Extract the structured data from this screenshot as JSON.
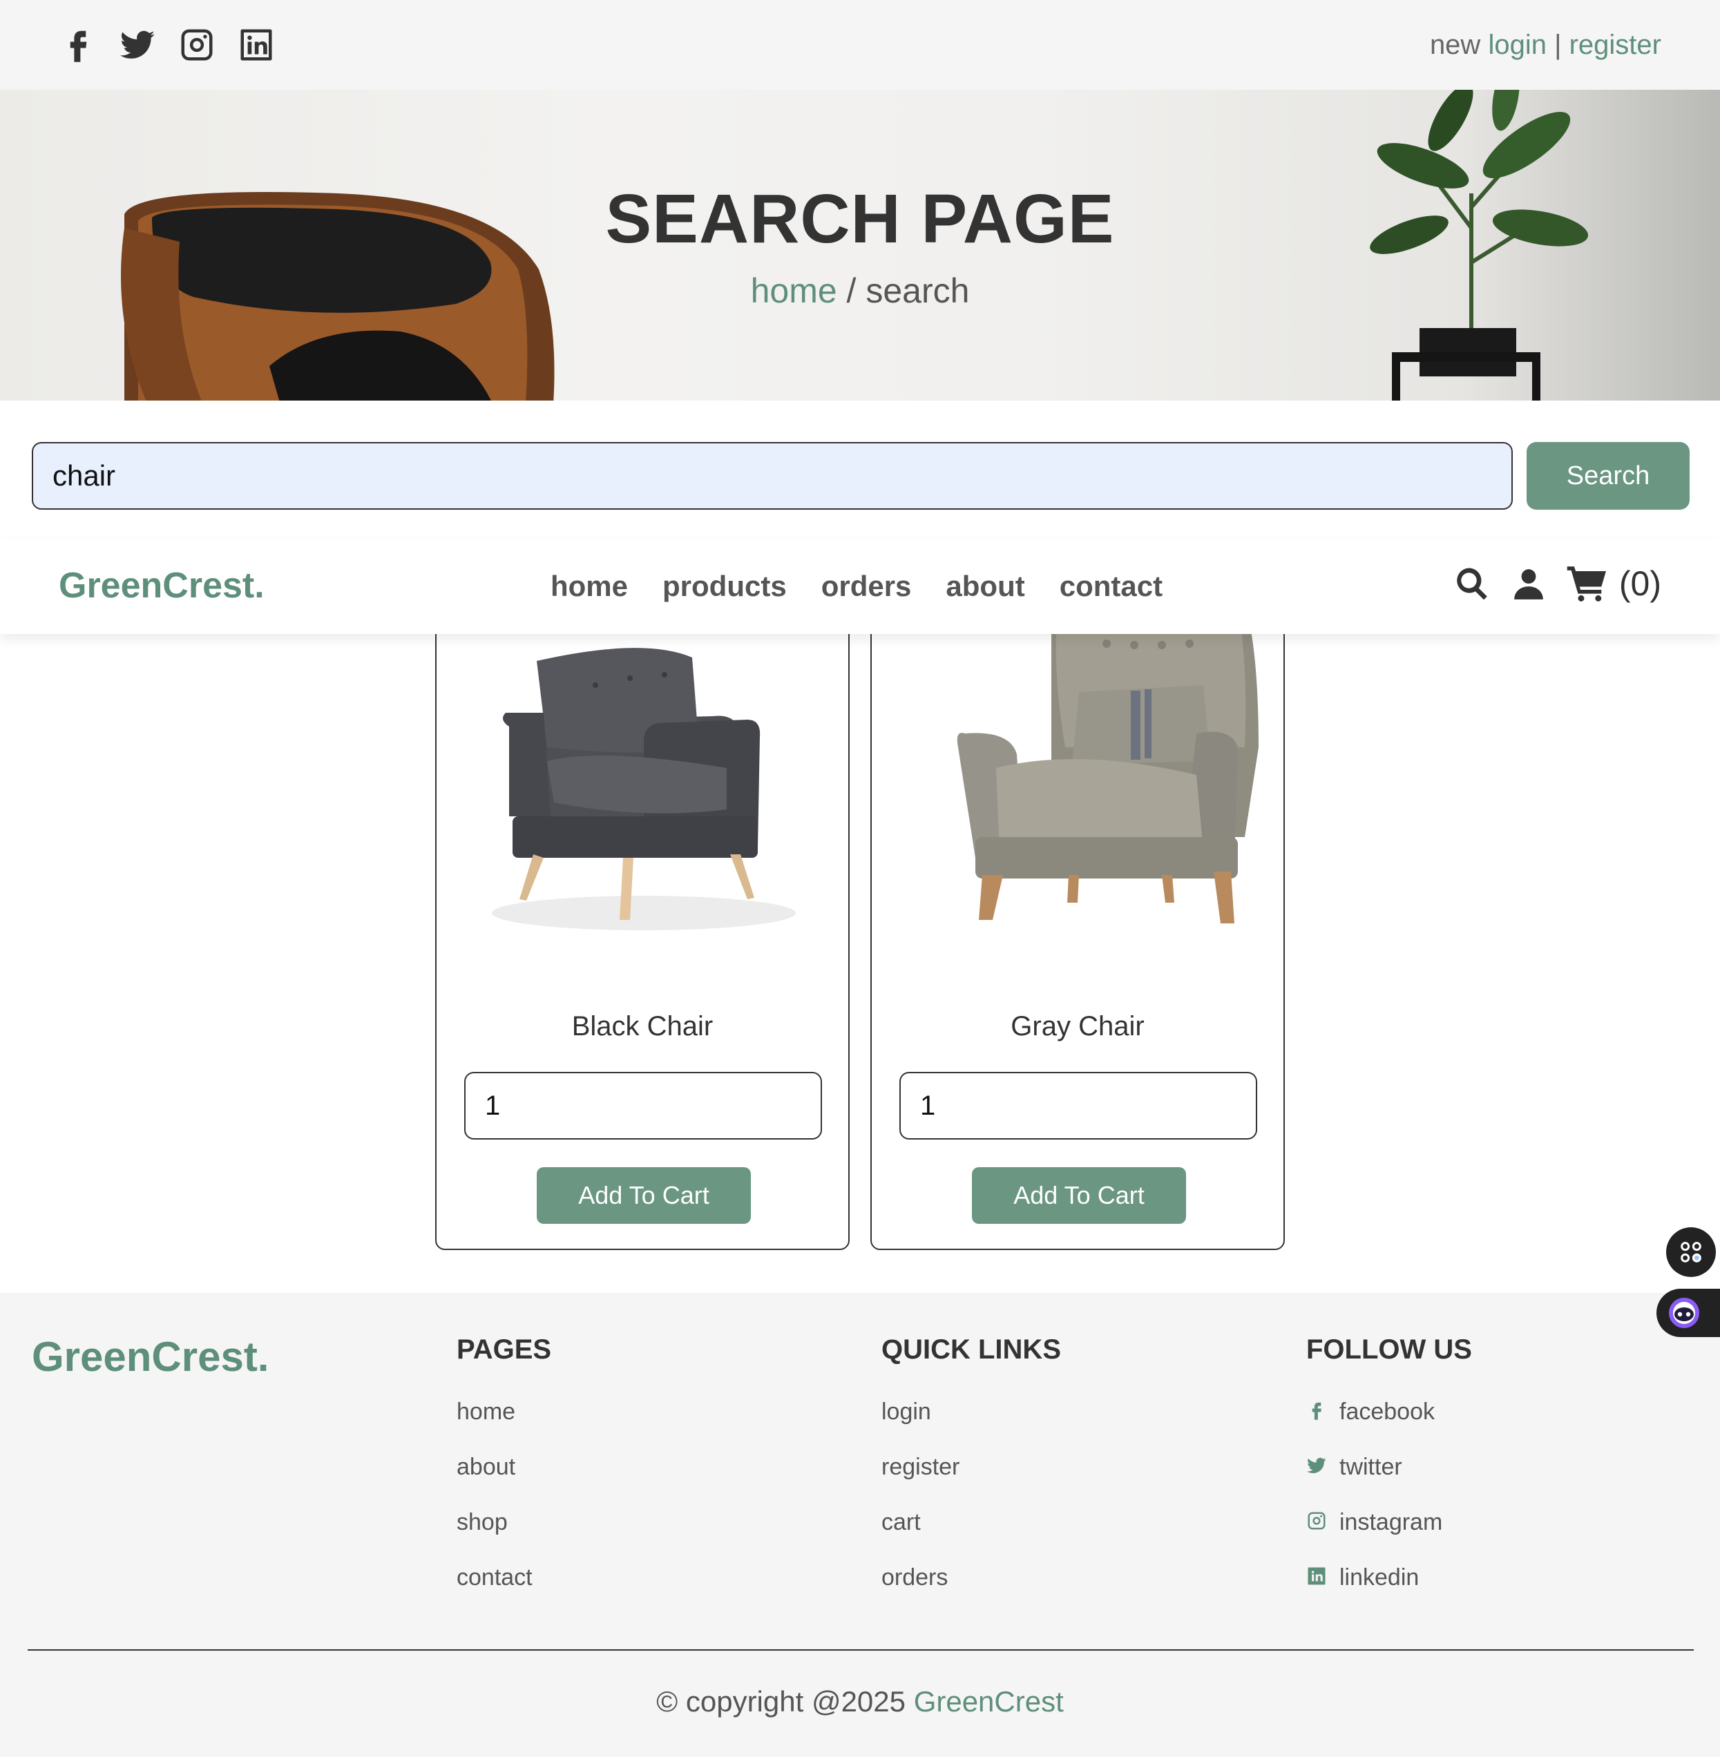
{
  "topbar": {
    "social_icons": [
      "facebook-icon",
      "twitter-icon",
      "instagram-icon",
      "linkedin-icon"
    ],
    "auth_prefix": "new",
    "login": "login",
    "separator": "|",
    "register": "register"
  },
  "hero": {
    "title": "SEARCH PAGE",
    "crumb_home": "home",
    "crumb_sep": " / ",
    "crumb_current": "search"
  },
  "search": {
    "value": "chair",
    "button": "Search"
  },
  "navbar": {
    "logo": "GreenCrest.",
    "menu": [
      "home",
      "products",
      "orders",
      "about",
      "contact"
    ],
    "cart_count": "(0)"
  },
  "products": [
    {
      "name": "Black Chair",
      "quantity": "1",
      "button": "Add To Cart"
    },
    {
      "name": "Gray Chair",
      "quantity": "1",
      "button": "Add To Cart"
    }
  ],
  "footer": {
    "logo": "GreenCrest.",
    "pages": {
      "title": "PAGES",
      "items": [
        "home",
        "about",
        "shop",
        "contact"
      ]
    },
    "quick_links": {
      "title": "QUICK LINKS",
      "items": [
        "login",
        "register",
        "cart",
        "orders"
      ]
    },
    "follow": {
      "title": "FOLLOW US",
      "items": [
        "facebook",
        "twitter",
        "instagram",
        "linkedin"
      ]
    },
    "copyright": "© copyright @2025",
    "brand": "GreenCrest"
  },
  "colors": {
    "accent": "#5e8f7b",
    "button": "#6a9682",
    "search_bg": "#e8f0fe",
    "footer_bg": "#f5f5f5"
  }
}
